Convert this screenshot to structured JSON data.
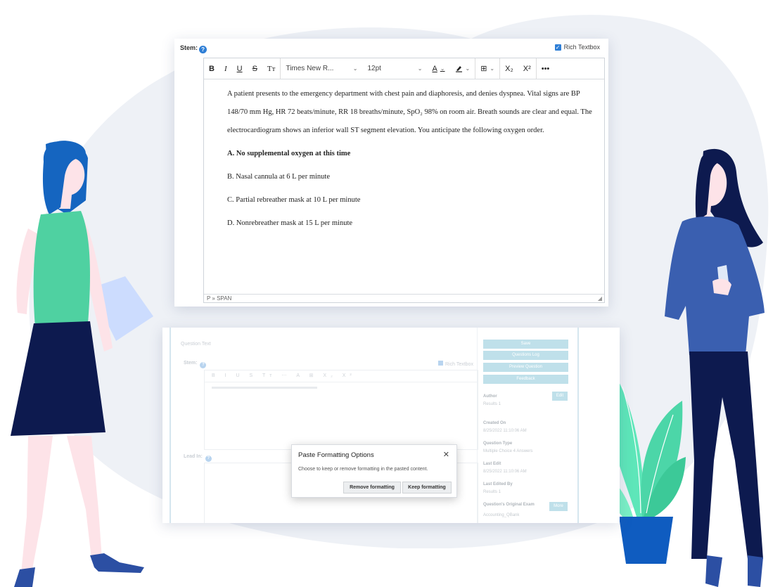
{
  "editor": {
    "stem_label": "Stem:",
    "rich_textbox_label": "Rich Textbox",
    "font_family": "Times New R...",
    "font_size": "12pt",
    "toolbar": {
      "bold": "B",
      "italic": "I",
      "underline": "U",
      "strikethrough": "S",
      "font_sizes": "Tт",
      "font_color": "A",
      "table": "⊞",
      "subscript": "X₂",
      "superscript": "X²",
      "more": "•••"
    },
    "stem_text": "A patient presents to the emergency department with chest pain and diaphoresis, and denies dyspnea. Vital signs are BP 148/70 mm Hg, HR 72 beats/minute, RR 18 breaths/minute, SpO₂ 98% on room air. Breath sounds are clear and equal. The electrocardiogram shows an inferior wall ST segment elevation. You anticipate the following oxygen order.",
    "options": [
      {
        "text": "A.  No supplemental oxygen at this time",
        "bold": true
      },
      {
        "text": "B.  Nasal cannula at 6 L per minute",
        "bold": false
      },
      {
        "text": "C.  Partial rebreather mask at 10 L per minute",
        "bold": false
      },
      {
        "text": "D.  Nonrebreather mask at 15 L per minute",
        "bold": false
      }
    ],
    "status_path": "P » SPAN"
  },
  "form": {
    "section_title": "Question Text",
    "stem_label": "Stem:",
    "rich_textbox_label": "Rich Textbox",
    "lead_in_label": "Lead In:",
    "sidebar": {
      "buttons": [
        "Save",
        "Questions Log",
        "Preview Question",
        "Feedback"
      ],
      "author_label": "Author",
      "author_value": "Results 1",
      "edit_button": "Edit",
      "created_on_label": "Created On",
      "created_on_value": "8/25/2022 11:10:06 AM",
      "question_type_label": "Question Type",
      "question_type_value": "Multiple Choice 4 Answers",
      "last_edit_label": "Last Edit",
      "last_edit_value": "8/25/2022 11:10:06 AM",
      "last_edited_by_label": "Last Edited By",
      "last_edited_by_value": "Results 1",
      "original_exam_label": "Question's Original Exam",
      "original_exam_value": "Accounting_QBank",
      "more_button": "More"
    }
  },
  "dialog": {
    "title": "Paste Formatting Options",
    "message": "Choose to keep or remove formatting in the pasted content.",
    "remove_button": "Remove formatting",
    "keep_button": "Keep formatting",
    "close": "✕"
  },
  "colors": {
    "background_blob": "#eef1f6",
    "accent_blue": "#2f7fd6",
    "shirt_green": "#4fd1a1",
    "skirt_navy": "#0d1a4f",
    "hair_blue": "#1565c0",
    "plant_green": "#5ee6b9",
    "pot_blue": "#0f5cc0",
    "sweater_blue": "#3a5fb0"
  }
}
